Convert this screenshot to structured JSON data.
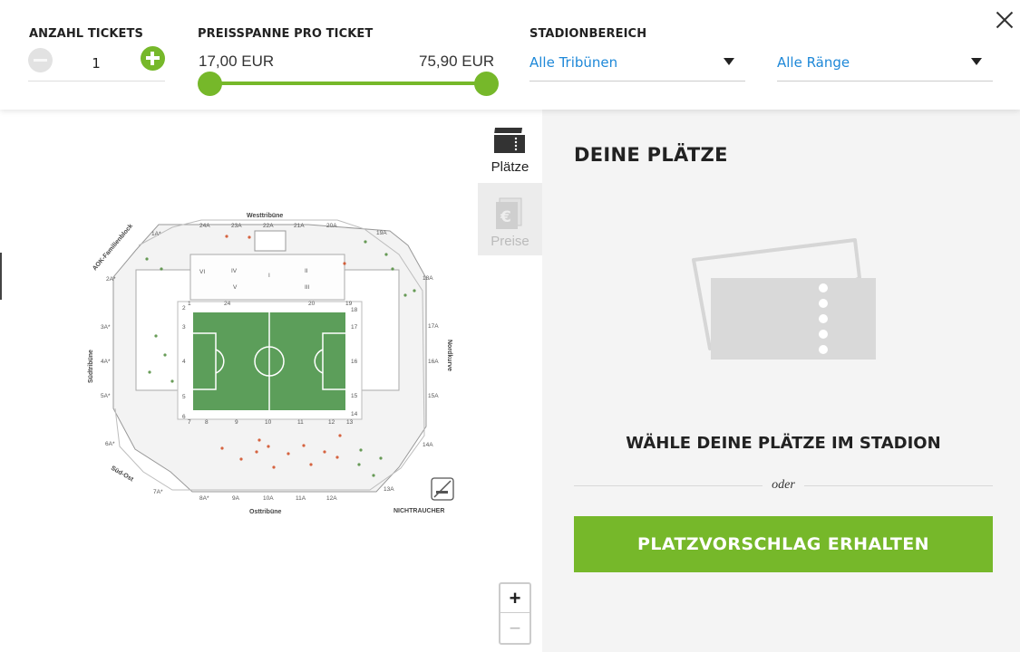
{
  "filters": {
    "tickets": {
      "label": "ANZAHL TICKETS",
      "quantity": "1"
    },
    "price": {
      "label": "PREISSPANNE PRO TICKET",
      "min": "17,00 EUR",
      "max": "75,90 EUR"
    },
    "area": {
      "label": "STADIONBEREICH",
      "stands_selected": "Alle Tribünen",
      "tiers_selected": "Alle Ränge"
    }
  },
  "tabs": [
    {
      "label": "Plätze",
      "icon": "tickets-icon",
      "active": true
    },
    {
      "label": "Preise",
      "icon": "euro-icon",
      "active": false
    }
  ],
  "stadium": {
    "stands": {
      "west": "Westtribüne",
      "east": "Osttribüne",
      "south": "Südtribüne",
      "north": "Nordkurve",
      "family": "AOK-Familienblock",
      "southeast": "Süd-Ost"
    },
    "non_smoking": "NICHTRAUCHER",
    "blocks": {
      "top_outer": [
        "24A",
        "23A",
        "22A",
        "21A",
        "20A"
      ],
      "top_right_outer": "19A",
      "bottom_outer": [
        "8A*",
        "9A",
        "10A",
        "11A",
        "12A"
      ],
      "bottom_right_outer": "13A",
      "left_outer": [
        "1A*",
        "2A*",
        "3A*",
        "4A*",
        "5A*",
        "6A*",
        "7A*"
      ],
      "right_outer": [
        "18A",
        "17A",
        "16A",
        "15A",
        "14A"
      ],
      "top_inner": [
        "24",
        "20",
        "19"
      ],
      "upper_ring": [
        "VI",
        "IV",
        "II",
        "I",
        "V",
        "III"
      ],
      "left_inner": [
        "1",
        "2",
        "3",
        "4",
        "5",
        "6",
        "7"
      ],
      "bottom_inner": [
        "8",
        "9",
        "10",
        "11",
        "12",
        "13"
      ],
      "right_inner": [
        "18",
        "17",
        "16",
        "15",
        "14"
      ]
    }
  },
  "zoom": {
    "in": "+",
    "out": "−"
  },
  "panel": {
    "title": "DEINE PLÄTZE",
    "prompt": "WÄHLE DEINE PLÄTZE IM STADION",
    "or": "oder",
    "cta": "PLATZVORSCHLAG ERHALTEN"
  },
  "colors": {
    "accent": "#76b82a",
    "link": "#1e88d8",
    "pitch": "#5c9e5a",
    "panel_bg": "#f4f4f4"
  }
}
